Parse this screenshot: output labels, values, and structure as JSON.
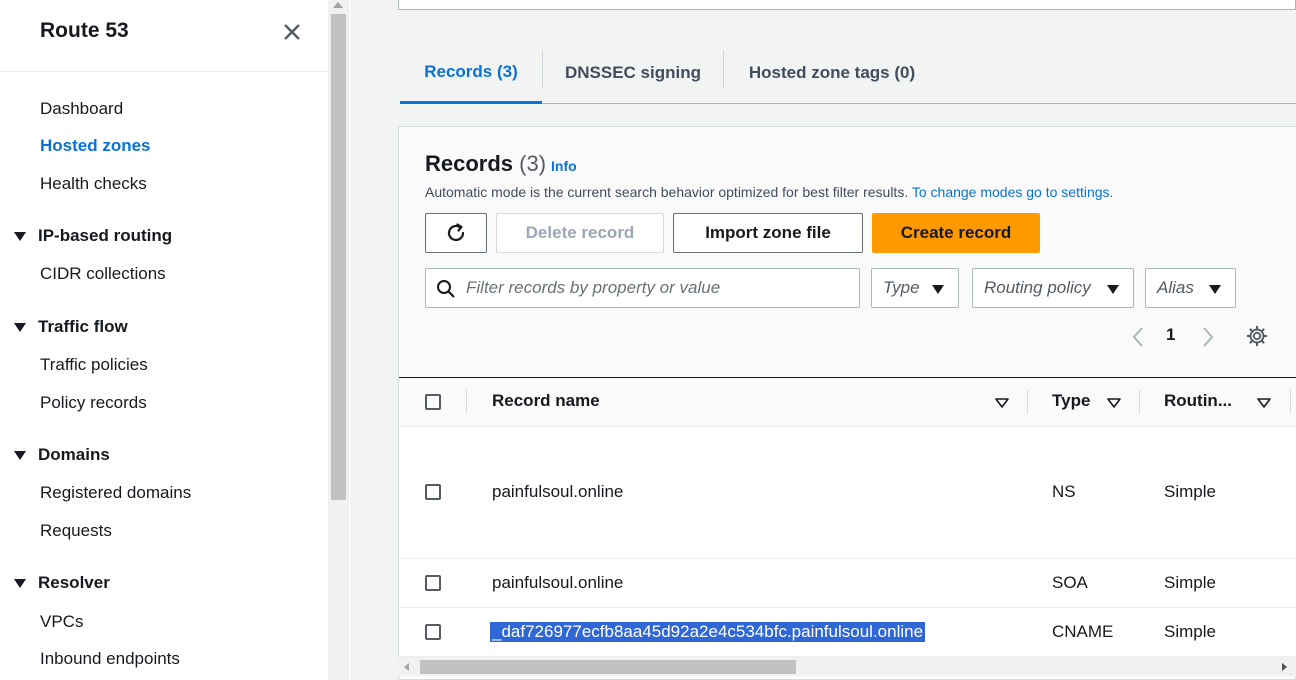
{
  "sidebar": {
    "title": "Route 53",
    "links": {
      "dashboard": "Dashboard",
      "hosted_zones": "Hosted zones",
      "health_checks": "Health checks",
      "cidr_collections": "CIDR collections",
      "traffic_policies": "Traffic policies",
      "policy_records": "Policy records",
      "registered_domains": "Registered domains",
      "requests": "Requests",
      "vpcs": "VPCs",
      "inbound_endpoints": "Inbound endpoints"
    },
    "sections": {
      "ip_routing": "IP-based routing",
      "traffic_flow": "Traffic flow",
      "domains": "Domains",
      "resolver": "Resolver"
    }
  },
  "tabs": [
    {
      "label": "Records (3)",
      "active": true
    },
    {
      "label": "DNSSEC signing",
      "active": false
    },
    {
      "label": "Hosted zone tags (0)",
      "active": false
    }
  ],
  "records": {
    "title": "Records",
    "count": "(3)",
    "info": "Info",
    "description": "Automatic mode is the current search behavior optimized for best filter results.",
    "description_link": "To change modes go to settings.",
    "buttons": {
      "delete": "Delete record",
      "import": "Import zone file",
      "create": "Create record"
    },
    "filter_placeholder": "Filter records by property or value",
    "selects": {
      "type": "Type",
      "routing": "Routing policy",
      "alias": "Alias"
    },
    "page": "1",
    "columns": {
      "name": "Record name",
      "type": "Type",
      "routing": "Routin..."
    },
    "rows": [
      {
        "name": "painfulsoul.online",
        "type": "NS",
        "routing": "Simple"
      },
      {
        "name": "painfulsoul.online",
        "type": "SOA",
        "routing": "Simple"
      },
      {
        "name": "_daf726977ecfb8aa45d92a2e4c534bfc.painfulsoul.online",
        "type": "CNAME",
        "routing": "Simple"
      }
    ]
  },
  "colors": {
    "link": "#0972d3",
    "primary": "#ff9900",
    "selection": "#3067d6"
  }
}
